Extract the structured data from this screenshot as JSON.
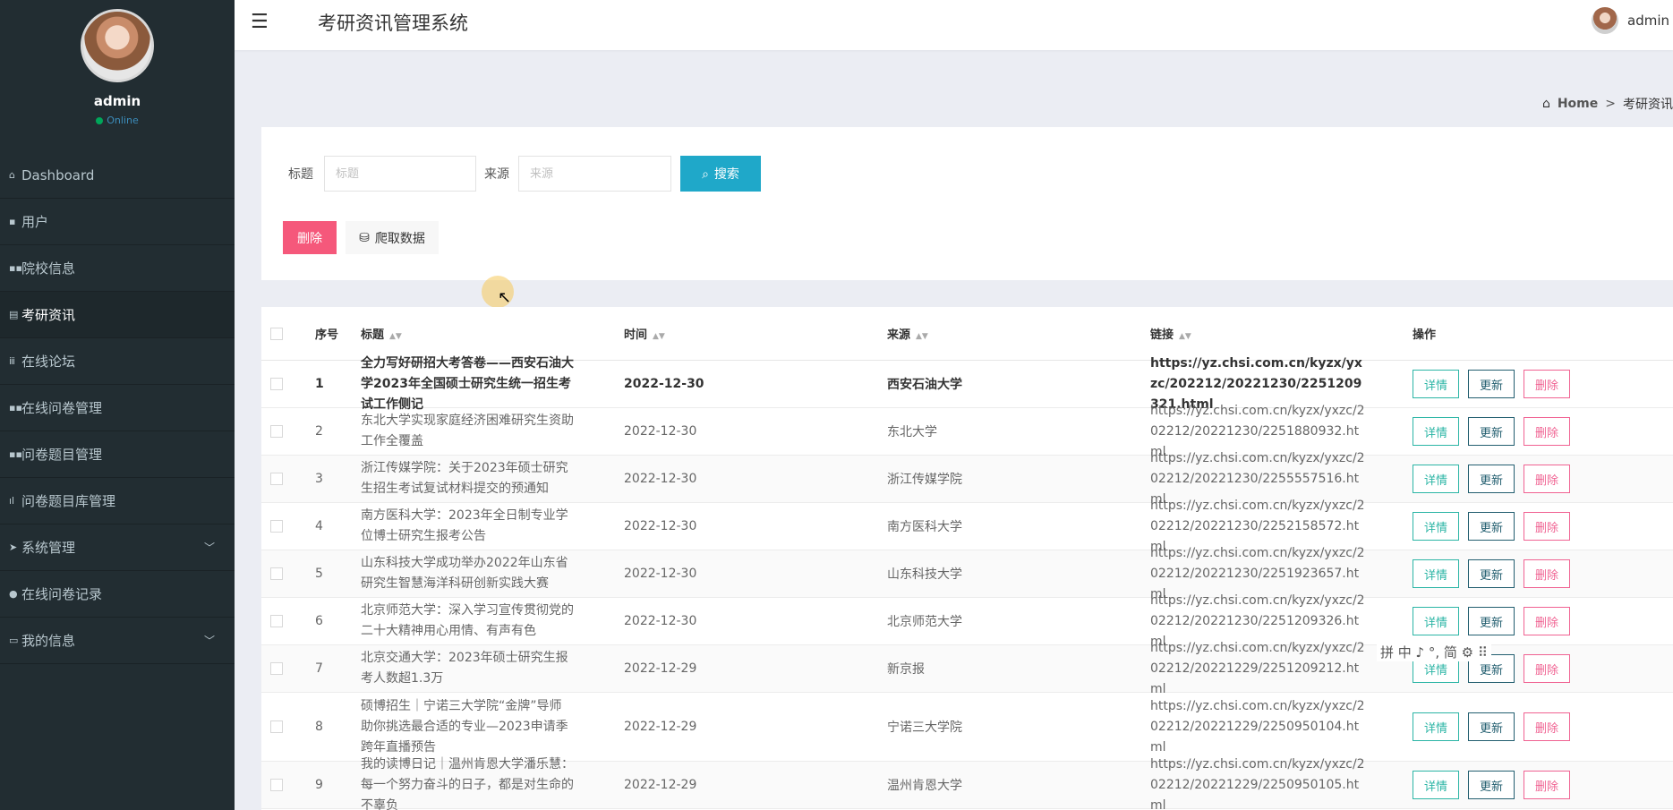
{
  "sidebar": {
    "user_name": "admin",
    "status": "Online",
    "items": [
      {
        "label": "Dashboard",
        "icon": "home-icon"
      },
      {
        "label": "用户",
        "icon": "user-icon"
      },
      {
        "label": "院校信息",
        "icon": "grid-icon"
      },
      {
        "label": "考研资讯",
        "icon": "list-icon"
      },
      {
        "label": "在线论坛",
        "icon": "bars-icon"
      },
      {
        "label": "在线问卷管理",
        "icon": "grid-icon"
      },
      {
        "label": "问卷题目管理",
        "icon": "grid-icon"
      },
      {
        "label": "问卷题目库管理",
        "icon": "chart-icon"
      },
      {
        "label": "系统管理",
        "icon": "send-icon"
      },
      {
        "label": "在线问卷记录",
        "icon": "pin-icon"
      },
      {
        "label": "我的信息",
        "icon": "card-icon"
      }
    ]
  },
  "header": {
    "title": "考研资讯管理系统",
    "user": "admin"
  },
  "breadcrumb": {
    "home": "Home",
    "sep": ">",
    "current": "考研资讯"
  },
  "search": {
    "title_label": "标题",
    "title_placeholder": "标题",
    "source_label": "来源",
    "source_placeholder": "来源",
    "search_button": "搜索",
    "delete_button": "删除",
    "crawl_button": "爬取数据"
  },
  "table": {
    "headers": {
      "no": "序号",
      "title": "标题",
      "time": "时间",
      "source": "来源",
      "link": "链接",
      "ops": "操作"
    },
    "op_labels": {
      "detail": "详情",
      "update": "更新",
      "delete": "删除"
    },
    "rows": [
      {
        "no": "1",
        "title": "全力写好研招大考答卷——西安石油大学2023年全国硕士研究生统一招生考试工作侧记",
        "time": "2022-12-30",
        "source": "西安石油大学",
        "link": "https://yz.chsi.com.cn/kyzx/yxzc/202212/20221230/2251209321.html"
      },
      {
        "no": "2",
        "title": "东北大学实现家庭经济困难研究生资助工作全覆盖",
        "time": "2022-12-30",
        "source": "东北大学",
        "link": "https://yz.chsi.com.cn/kyzx/yxzc/202212/20221230/2251880932.html"
      },
      {
        "no": "3",
        "title": "浙江传媒学院：关于2023年硕士研究生招生考试复试材料提交的预通知",
        "time": "2022-12-30",
        "source": "浙江传媒学院",
        "link": "https://yz.chsi.com.cn/kyzx/yxzc/202212/20221230/2255557516.html"
      },
      {
        "no": "4",
        "title": "南方医科大学：2023年全日制专业学位博士研究生报考公告",
        "time": "2022-12-30",
        "source": "南方医科大学",
        "link": "https://yz.chsi.com.cn/kyzx/yxzc/202212/20221230/2252158572.html"
      },
      {
        "no": "5",
        "title": "山东科技大学成功举办2022年山东省研究生智慧海洋科研创新实践大赛",
        "time": "2022-12-30",
        "source": "山东科技大学",
        "link": "https://yz.chsi.com.cn/kyzx/yxzc/202212/20221230/2251923657.html"
      },
      {
        "no": "6",
        "title": "北京师范大学：深入学习宣传贯彻党的二十大精神用心用情、有声有色",
        "time": "2022-12-30",
        "source": "北京师范大学",
        "link": "https://yz.chsi.com.cn/kyzx/yxzc/202212/20221230/2251209326.html"
      },
      {
        "no": "7",
        "title": "北京交通大学：2023年硕士研究生报考人数超1.3万",
        "time": "2022-12-29",
        "source": "新京报",
        "link": "https://yz.chsi.com.cn/kyzx/yxzc/202212/20221229/2251209212.html"
      },
      {
        "no": "8",
        "title": "硕博招生｜宁诺三大学院“金牌”导师助你挑选最合适的专业—2023申请季跨年直播预告",
        "time": "2022-12-29",
        "source": "宁诺三大学院",
        "link": "https://yz.chsi.com.cn/kyzx/yxzc/202212/20221229/2250950104.html"
      },
      {
        "no": "9",
        "title": "我的读博日记｜温州肯恩大学潘乐慧：每一个努力奋斗的日子，都是对生命的不辜负",
        "time": "2022-12-29",
        "source": "温州肯恩大学",
        "link": "https://yz.chsi.com.cn/kyzx/yxzc/202212/20221229/2250950105.html"
      }
    ]
  },
  "ime_bar": "拼 中 ♪ °, 简 ⚙ ⠿"
}
